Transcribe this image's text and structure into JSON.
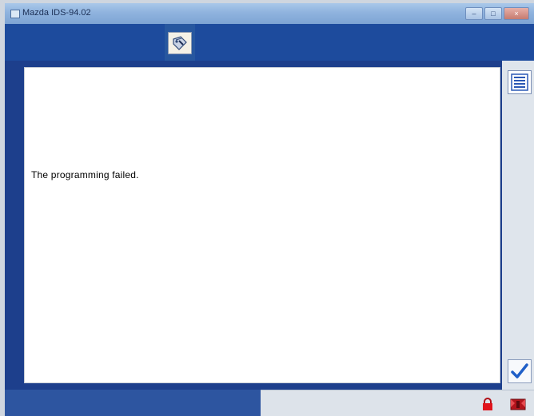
{
  "window": {
    "title": "Mazda IDS-94.02"
  },
  "title_buttons": {
    "minimize": "–",
    "maximize": "□",
    "close": "×"
  },
  "header": {
    "tab_icon": "programming-tool-icon"
  },
  "content": {
    "message": "The programming failed."
  },
  "sidebar": {
    "list_icon": "list-icon",
    "confirm_icon": "checkmark-icon"
  },
  "statusbar": {
    "lock_icon": "lock-icon",
    "exit_icon": "exit-icon"
  },
  "colors": {
    "header_blue": "#1d4b9d",
    "status_blue": "#2d55a0",
    "check_blue": "#1f5fc8",
    "lock_red": "#e0141c"
  }
}
